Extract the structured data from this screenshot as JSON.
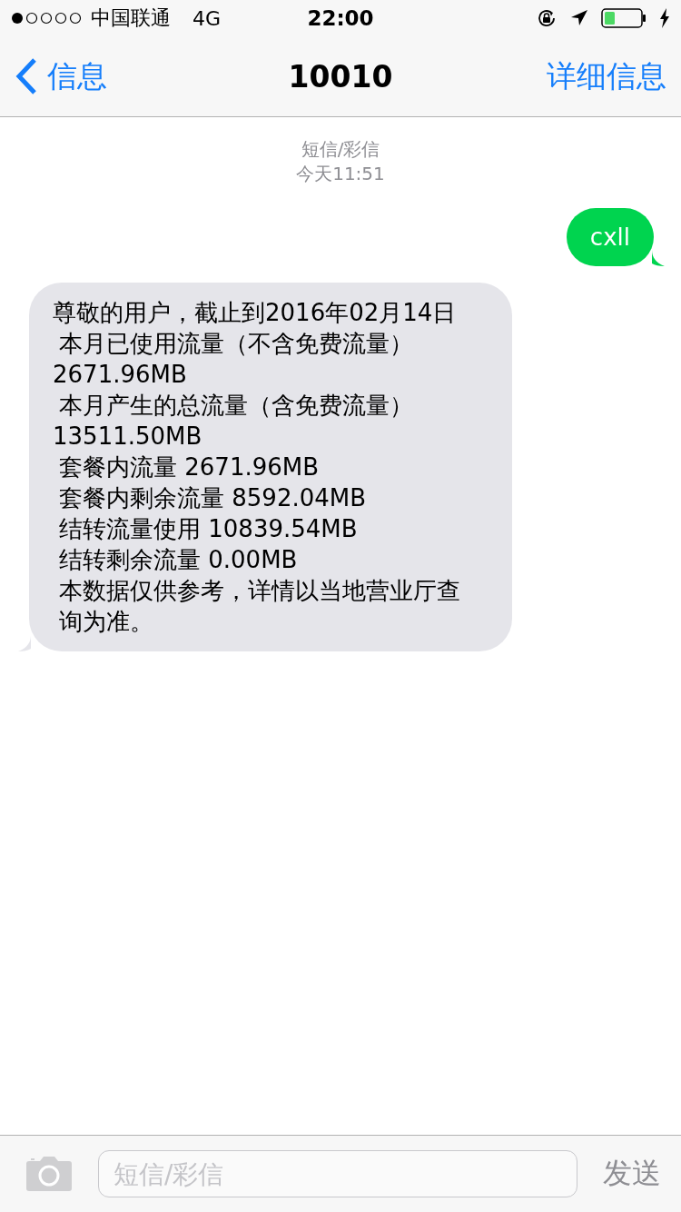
{
  "status_bar": {
    "carrier": "中国联通",
    "network": "4G",
    "time": "22:00"
  },
  "nav": {
    "back": "信息",
    "title": "10010",
    "action": "详细信息"
  },
  "thread": {
    "service": "短信/彩信",
    "timestamp": "今天11:51",
    "messages": [
      {
        "kind": "sent",
        "text": "cxll"
      },
      {
        "kind": "received",
        "lines": [
          {
            "text": "尊敬的用户，截止到2016年02月14日",
            "indent": false
          },
          {
            "text": "本月已使用流量（不含免费流量）",
            "indent": true
          },
          {
            "text": "2671.96MB",
            "indent": false
          },
          {
            "text": "本月产生的总流量（含免费流量）",
            "indent": true
          },
          {
            "text": "13511.50MB",
            "indent": false
          },
          {
            "text": "套餐内流量 2671.96MB",
            "indent": true
          },
          {
            "text": "套餐内剩余流量 8592.04MB",
            "indent": true
          },
          {
            "text": "结转流量使用 10839.54MB",
            "indent": true
          },
          {
            "text": "结转剩余流量 0.00MB",
            "indent": true
          },
          {
            "text": "本数据仅供参考，详情以当地营业厅查询为准。",
            "indent": true
          }
        ]
      }
    ]
  },
  "composer": {
    "placeholder": "短信/彩信",
    "send": "发送",
    "send_disabled": true
  }
}
